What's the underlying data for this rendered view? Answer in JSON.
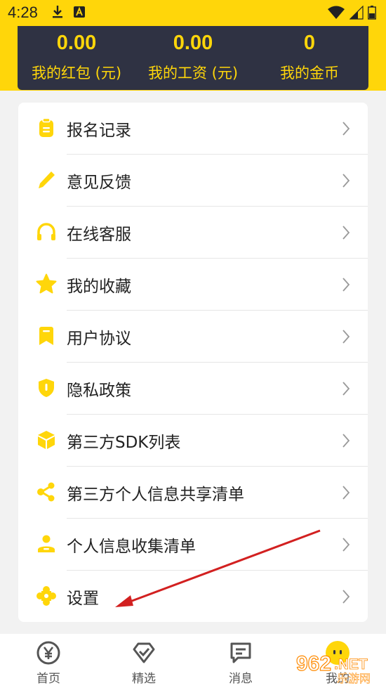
{
  "status_bar": {
    "time": "4:28",
    "icons": [
      "download-icon",
      "a-notification-icon",
      "wifi-icon",
      "signal-icon",
      "battery-icon"
    ]
  },
  "colors": {
    "accent_yellow": "#ffd60a",
    "stats_bg": "#2f3243",
    "arrow_red": "#d22020"
  },
  "stats": [
    {
      "value": "0.00",
      "label": "我的红包 (元)"
    },
    {
      "value": "0.00",
      "label": "我的工资 (元)"
    },
    {
      "value": "0",
      "label": "我的金币"
    }
  ],
  "menu": [
    {
      "label": "报名记录",
      "icon": "clipboard-icon"
    },
    {
      "label": "意见反馈",
      "icon": "pencil-icon"
    },
    {
      "label": "在线客服",
      "icon": "headset-icon"
    },
    {
      "label": "我的收藏",
      "icon": "star-icon"
    },
    {
      "label": "用户协议",
      "icon": "bookmark-icon"
    },
    {
      "label": "隐私政策",
      "icon": "shield-icon"
    },
    {
      "label": "第三方SDK列表",
      "icon": "cube-icon"
    },
    {
      "label": "第三方个人信息共享清单",
      "icon": "share-icon"
    },
    {
      "label": "个人信息收集清单",
      "icon": "user-icon"
    },
    {
      "label": "设置",
      "icon": "settings-icon"
    }
  ],
  "tabs": [
    {
      "label": "首页",
      "icon": "yuan-icon"
    },
    {
      "label": "精选",
      "icon": "diamond-icon"
    },
    {
      "label": "消息",
      "icon": "message-icon"
    },
    {
      "label": "我的",
      "icon": "profile-icon"
    }
  ],
  "watermark": {
    "text_main": "962",
    "text_net": ".NET",
    "text_sub": "乐游网"
  }
}
